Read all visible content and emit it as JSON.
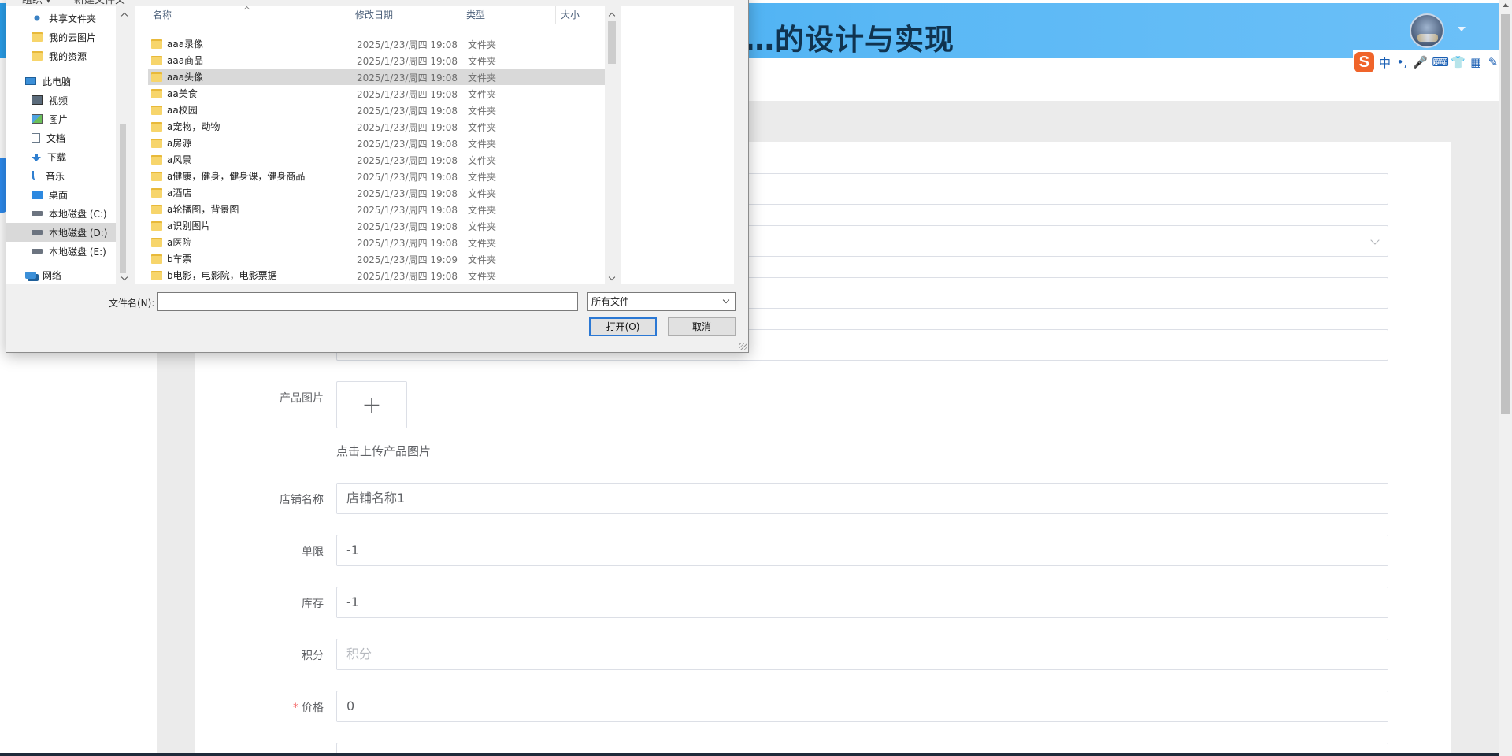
{
  "app": {
    "title": "…的设计与实现"
  },
  "ime": {
    "logo": "S",
    "items": [
      "中",
      "•,",
      "🎤",
      "⌨",
      "👕",
      "▦",
      "✎"
    ]
  },
  "form": {
    "product_image_label": "产品图片",
    "upload_plus": "+",
    "upload_hint": "点击上传产品图片",
    "shop_name_label": "店铺名称",
    "shop_name_value": "店铺名称1",
    "limit_label": "单限",
    "limit_value": "-1",
    "stock_label": "库存",
    "stock_value": "-1",
    "points_label": "积分",
    "points_placeholder": "积分",
    "price_required_mark": "*",
    "price_label": "价格",
    "price_value": "0"
  },
  "dialog": {
    "toolbar": {
      "organize": "组织 ▾",
      "new_folder": "新建文件夹"
    },
    "nav_items": [
      {
        "label": "共享文件夹",
        "icon": "share-icon"
      },
      {
        "label": "我的云图片",
        "icon": "folder-icon"
      },
      {
        "label": "我的资源",
        "icon": "folder-icon"
      },
      {
        "label": "此电脑",
        "icon": "computer-icon"
      },
      {
        "label": "视频",
        "icon": "video-icon"
      },
      {
        "label": "图片",
        "icon": "picture-icon"
      },
      {
        "label": "文档",
        "icon": "document-icon"
      },
      {
        "label": "下载",
        "icon": "download-icon"
      },
      {
        "label": "音乐",
        "icon": "music-icon"
      },
      {
        "label": "桌面",
        "icon": "desktop-icon"
      },
      {
        "label": "本地磁盘 (C:)",
        "icon": "drive-icon"
      },
      {
        "label": "本地磁盘 (D:)",
        "icon": "drive-icon"
      },
      {
        "label": "本地磁盘 (E:)",
        "icon": "drive-icon"
      },
      {
        "label": "网络",
        "icon": "network-icon"
      }
    ],
    "columns": {
      "name": "名称",
      "modified": "修改日期",
      "type": "类型",
      "size": "大小"
    },
    "files": [
      {
        "name": "aaa录像",
        "date": "2025/1/23/周四 19:08",
        "type": "文件夹"
      },
      {
        "name": "aaa商品",
        "date": "2025/1/23/周四 19:08",
        "type": "文件夹"
      },
      {
        "name": "aaa头像",
        "date": "2025/1/23/周四 19:08",
        "type": "文件夹"
      },
      {
        "name": "aa美食",
        "date": "2025/1/23/周四 19:08",
        "type": "文件夹"
      },
      {
        "name": "aa校园",
        "date": "2025/1/23/周四 19:08",
        "type": "文件夹"
      },
      {
        "name": "a宠物，动物",
        "date": "2025/1/23/周四 19:08",
        "type": "文件夹"
      },
      {
        "name": "a房源",
        "date": "2025/1/23/周四 19:08",
        "type": "文件夹"
      },
      {
        "name": "a风景",
        "date": "2025/1/23/周四 19:08",
        "type": "文件夹"
      },
      {
        "name": "a健康，健身，健身课，健身商品",
        "date": "2025/1/23/周四 19:08",
        "type": "文件夹"
      },
      {
        "name": "a酒店",
        "date": "2025/1/23/周四 19:08",
        "type": "文件夹"
      },
      {
        "name": "a轮播图，背景图",
        "date": "2025/1/23/周四 19:08",
        "type": "文件夹"
      },
      {
        "name": "a识别图片",
        "date": "2025/1/23/周四 19:08",
        "type": "文件夹"
      },
      {
        "name": "a医院",
        "date": "2025/1/23/周四 19:08",
        "type": "文件夹"
      },
      {
        "name": "b车票",
        "date": "2025/1/23/周四 19:09",
        "type": "文件夹"
      },
      {
        "name": "b电影，电影院，电影票据",
        "date": "2025/1/23/周四 19:08",
        "type": "文件夹"
      }
    ],
    "filename_label": "文件名(N):",
    "filename_value": "",
    "filter": "所有文件",
    "open_button": "打开(O)",
    "cancel_button": "取消"
  }
}
